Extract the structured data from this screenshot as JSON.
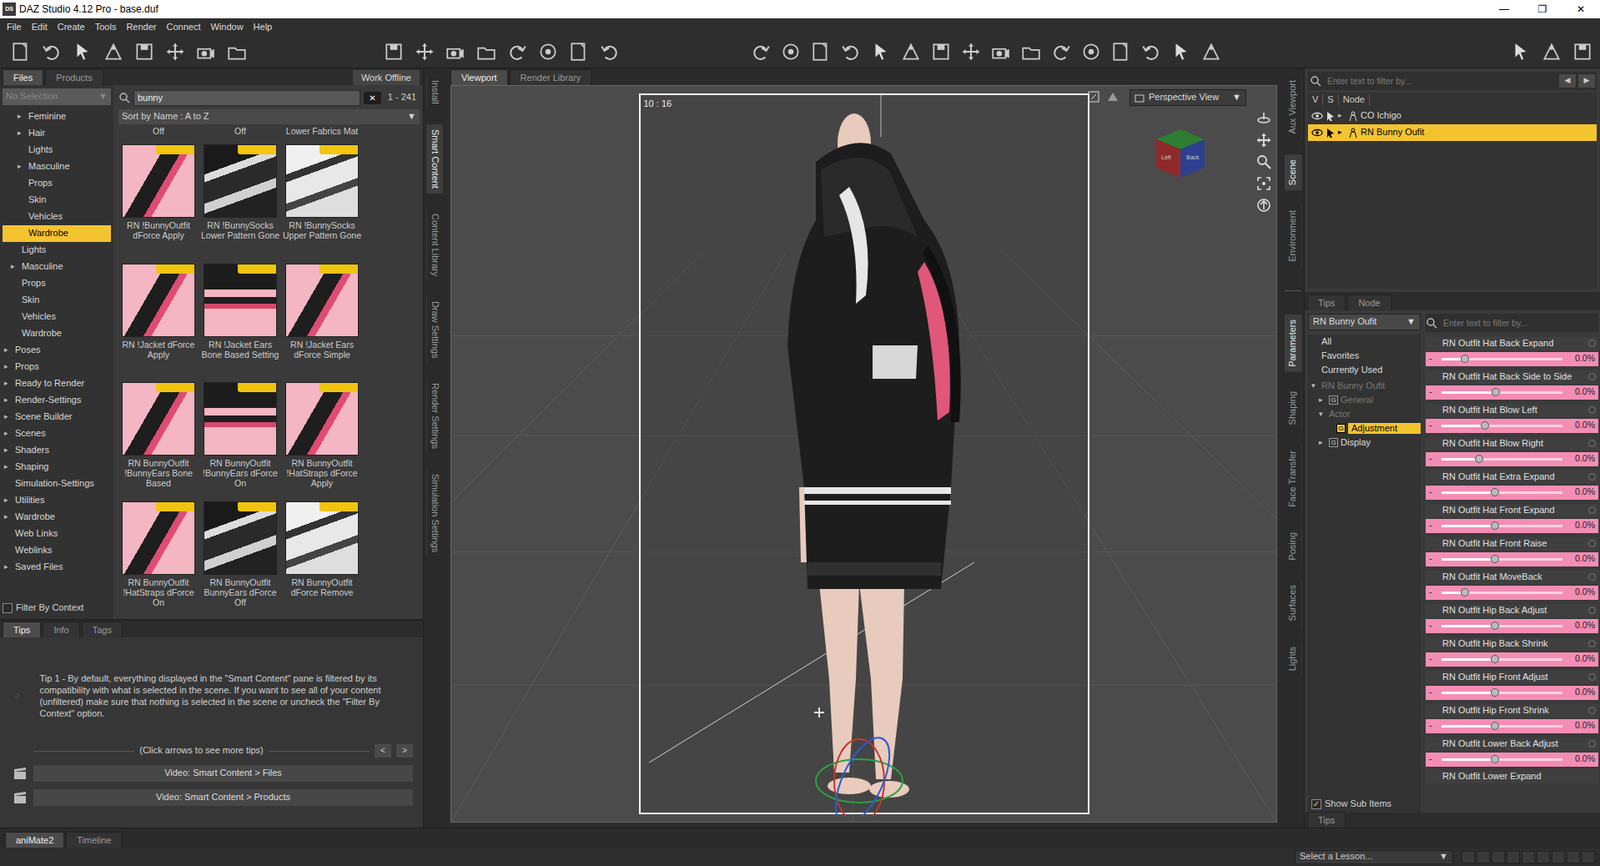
{
  "window": {
    "logo": "DS",
    "title": "DAZ Studio 4.12 Pro - base.duf",
    "controls": [
      "—",
      "❐",
      "✕"
    ]
  },
  "menu": [
    "File",
    "Edit",
    "Create",
    "Tools",
    "Render",
    "Connect",
    "Window",
    "Help"
  ],
  "left_panel": {
    "tabs": [
      {
        "label": "Files",
        "selected": true
      },
      {
        "label": "Products",
        "selected": false
      }
    ],
    "work_offline": "Work Offline",
    "selector": {
      "value": "No Selection",
      "arrow": "▼"
    },
    "tree": [
      {
        "label": "Feminine",
        "toggle": "▸",
        "depth": 2,
        "selected": false
      },
      {
        "label": "Hair",
        "toggle": "▸",
        "depth": 2,
        "selected": false
      },
      {
        "label": "Lights",
        "toggle": "",
        "depth": 2,
        "selected": false
      },
      {
        "label": "Masculine",
        "toggle": "▸",
        "depth": 2,
        "selected": false
      },
      {
        "label": "Props",
        "toggle": "",
        "depth": 2,
        "selected": false
      },
      {
        "label": "Skin",
        "toggle": "",
        "depth": 2,
        "selected": false
      },
      {
        "label": "Vehicles",
        "toggle": "",
        "depth": 2,
        "selected": false
      },
      {
        "label": "Wardrobe",
        "toggle": "",
        "depth": 2,
        "selected": true
      },
      {
        "label": "Lights",
        "toggle": "",
        "depth": 1,
        "selected": false
      },
      {
        "label": "Masculine",
        "toggle": "▸",
        "depth": 1,
        "selected": false
      },
      {
        "label": "Props",
        "toggle": "",
        "depth": 1,
        "selected": false
      },
      {
        "label": "Skin",
        "toggle": "",
        "depth": 1,
        "selected": false
      },
      {
        "label": "Vehicles",
        "toggle": "",
        "depth": 1,
        "selected": false
      },
      {
        "label": "Wardrobe",
        "toggle": "",
        "depth": 1,
        "selected": false
      },
      {
        "label": "Poses",
        "toggle": "▸",
        "depth": 0,
        "selected": false
      },
      {
        "label": "Props",
        "toggle": "▸",
        "depth": 0,
        "selected": false
      },
      {
        "label": "Ready to Render",
        "toggle": "▸",
        "depth": 0,
        "selected": false
      },
      {
        "label": "Render-Settings",
        "toggle": "▸",
        "depth": 0,
        "selected": false
      },
      {
        "label": "Scene Builder",
        "toggle": "▸",
        "depth": 0,
        "selected": false
      },
      {
        "label": "Scenes",
        "toggle": "▸",
        "depth": 0,
        "selected": false
      },
      {
        "label": "Shaders",
        "toggle": "▸",
        "depth": 0,
        "selected": false
      },
      {
        "label": "Shaping",
        "toggle": "▸",
        "depth": 0,
        "selected": false
      },
      {
        "label": "Simulation-Settings",
        "toggle": "",
        "depth": 0,
        "selected": false
      },
      {
        "label": "Utilities",
        "toggle": "▸",
        "depth": 0,
        "selected": false
      },
      {
        "label": "Wardrobe",
        "toggle": "▸",
        "depth": 0,
        "selected": false
      },
      {
        "label": "Web Links",
        "toggle": "",
        "depth": 0,
        "selected": false
      },
      {
        "label": "Weblinks",
        "toggle": "",
        "depth": 0,
        "selected": false
      },
      {
        "label": "Saved Files",
        "toggle": "▸",
        "depth": 0,
        "selected": false
      }
    ],
    "filter_by_context": {
      "label": "Filter By Context",
      "checked": false
    },
    "search": {
      "value": "bunny",
      "clear": "✕",
      "count": "1 - 241"
    },
    "sort": {
      "value": "Sort by Name : A to Z",
      "arrow": "▼"
    },
    "partial_labels": [
      "Off",
      "Off",
      "Lower Fabrics Mat"
    ],
    "items": [
      {
        "label": "RN !BunnyOutfit dForce Apply",
        "kind": "pink"
      },
      {
        "label": "RN !BunnySocks Lower Pattern Gone",
        "kind": "dark"
      },
      {
        "label": "RN !BunnySocks Upper Pattern Gone",
        "kind": "light"
      },
      {
        "label": "RN !Jacket dForce Apply",
        "kind": "pink"
      },
      {
        "label": "RN !Jacket Ears Bone Based Setting",
        "kind": "mixed"
      },
      {
        "label": "RN !Jacket Ears dForce Simple",
        "kind": "pink"
      },
      {
        "label": "RN BunnyOutfit !BunnyEars Bone Based",
        "kind": "pink"
      },
      {
        "label": "RN BunnyOutfit !BunnyEars dForce On",
        "kind": "mixed"
      },
      {
        "label": "RN BunnyOutfit !HatStraps dForce Apply",
        "kind": "pink"
      },
      {
        "label": "RN BunnyOutfit !HatStraps dForce On",
        "kind": "pink"
      },
      {
        "label": "RN BunnyOutfit BunnyEars dForce Off",
        "kind": "dark"
      },
      {
        "label": "RN BunnyOutfit dForce Remove",
        "kind": "light"
      }
    ]
  },
  "vertical_tabs_left": [
    {
      "label": "Install",
      "selected": false
    },
    {
      "label": "Smart Content",
      "selected": true
    },
    {
      "label": "Content Library",
      "selected": false
    },
    {
      "label": "Draw Settings",
      "selected": false
    },
    {
      "label": "Render Settings",
      "selected": false
    },
    {
      "label": "Simulation Settings",
      "selected": false
    }
  ],
  "tips": {
    "tabs": [
      {
        "label": "Tips",
        "selected": true
      },
      {
        "label": "Info",
        "selected": false
      },
      {
        "label": "Tags",
        "selected": false
      }
    ],
    "text": "Tip 1 - By default, everything displayed in the \"Smart Content\" pane is filtered by its compatibility with what is selected in the scene. If you want to see all of your content (unfiltered) make sure that nothing is selected in the scene or uncheck the \"Filter By Context\" option.",
    "hint": "(Click arrows to see more tips)",
    "prev": "<",
    "next": ">",
    "videos": [
      "Video: Smart Content > Files",
      "Video: Smart Content > Products"
    ]
  },
  "viewport": {
    "tabs": [
      {
        "label": "Viewport",
        "selected": true
      },
      {
        "label": "Render Library",
        "selected": false
      }
    ],
    "aspect": "10 : 16",
    "view": "Perspective View",
    "view_arrow": "▼",
    "cube": [
      "Left",
      "Back"
    ]
  },
  "right_vertical_tabs_top": [
    {
      "label": "Aux Viewport",
      "selected": false
    },
    {
      "label": "Scene",
      "selected": true
    },
    {
      "label": "Environment",
      "selected": false
    }
  ],
  "right_vertical_tabs_bottom": [
    {
      "label": "Parameters",
      "selected": true
    },
    {
      "label": "Shaping",
      "selected": false
    },
    {
      "label": "Face Transfer",
      "selected": false
    },
    {
      "label": "Posing",
      "selected": false
    },
    {
      "label": "Surfaces",
      "selected": false
    },
    {
      "label": "Lights",
      "selected": false
    }
  ],
  "scene": {
    "search_placeholder": "Enter text to filter by...",
    "nav": [
      "◀",
      "▶"
    ],
    "columns": [
      "V",
      "S",
      "Node"
    ],
    "nodes": [
      {
        "label": "CO Ichigo",
        "toggle": "▸",
        "selected": false
      },
      {
        "label": "RN Bunny Oufit",
        "toggle": "▸",
        "selected": true
      }
    ],
    "tabs": [
      {
        "label": "Tips",
        "selected": false
      },
      {
        "label": "Node",
        "selected": false
      }
    ]
  },
  "parameters": {
    "node": "RN Bunny Oufit",
    "arrow": "▼",
    "filter_placeholder": "Enter text to filter by...",
    "tree": [
      {
        "label": "All",
        "toggle": "",
        "badge": "",
        "depth": 0,
        "dimmed": false,
        "selected": false
      },
      {
        "label": "Favorites",
        "toggle": "",
        "badge": "",
        "depth": 0,
        "dimmed": false,
        "selected": false
      },
      {
        "label": "Currently Used",
        "toggle": "",
        "badge": "",
        "depth": 0,
        "dimmed": false,
        "selected": false
      },
      {
        "label": "RN Bunny Oufit",
        "toggle": "▾",
        "badge": "",
        "depth": 0,
        "dimmed": true,
        "selected": false
      },
      {
        "label": "General",
        "toggle": "▸",
        "badge": "G",
        "depth": 1,
        "dimmed": true,
        "selected": false
      },
      {
        "label": "Actor",
        "toggle": "▾",
        "badge": "",
        "depth": 1,
        "dimmed": true,
        "selected": false
      },
      {
        "label": "Adjustment",
        "toggle": "",
        "badge": "G",
        "depth": 2,
        "dimmed": false,
        "selected": true
      },
      {
        "label": "Display",
        "toggle": "▸",
        "badge": "G",
        "depth": 1,
        "dimmed": false,
        "selected": false
      }
    ],
    "show_sub_items": {
      "label": "Show Sub Items",
      "checked": true,
      "mark": "✓"
    },
    "minus": "-",
    "sliders": [
      {
        "label": "RN Outfit Hat Back Expand",
        "reading": "0.0%",
        "level": 0.19
      },
      {
        "label": "RN Outfit Hat Back Side to Side",
        "reading": "0.0%",
        "level": 0.45
      },
      {
        "label": "RN Outfit Hat Blow Left",
        "reading": "0.0%",
        "level": 0.36
      },
      {
        "label": "RN Outfit Hat Blow Right",
        "reading": "0.0%",
        "level": 0.31
      },
      {
        "label": "RN Outfit Hat Extra Expand",
        "reading": "0.0%",
        "level": 0.44
      },
      {
        "label": "RN Outfit Hat Front Expand",
        "reading": "0.0%",
        "level": 0.44
      },
      {
        "label": "RN Outfit Hat Front Raise",
        "reading": "0.0%",
        "level": 0.44
      },
      {
        "label": "RN Outfit Hat MoveBack",
        "reading": "0.0%",
        "level": 0.19
      },
      {
        "label": "RN Outfit Hip Back Adjust",
        "reading": "0.0%",
        "level": 0.44
      },
      {
        "label": "RN Outfit Hip Back Shrink",
        "reading": "0.0%",
        "level": 0.44
      },
      {
        "label": "RN Outfit Hip Front Adjust",
        "reading": "0.0%",
        "level": 0.44
      },
      {
        "label": "RN Outfit Hip Front Shrink",
        "reading": "0.0%",
        "level": 0.44
      },
      {
        "label": "RN Outfit Lower Back Adjust",
        "reading": "0.0%",
        "level": 0.44
      }
    ],
    "cut_label": "RN Outfit Lower Expand",
    "bottom_tab": "Tips"
  },
  "bottom": {
    "tabs": [
      {
        "label": "aniMate2",
        "selected": true
      },
      {
        "label": "Timeline",
        "selected": false
      }
    ],
    "lesson": "Select a Lesson...",
    "lesson_arrow": "▼"
  }
}
